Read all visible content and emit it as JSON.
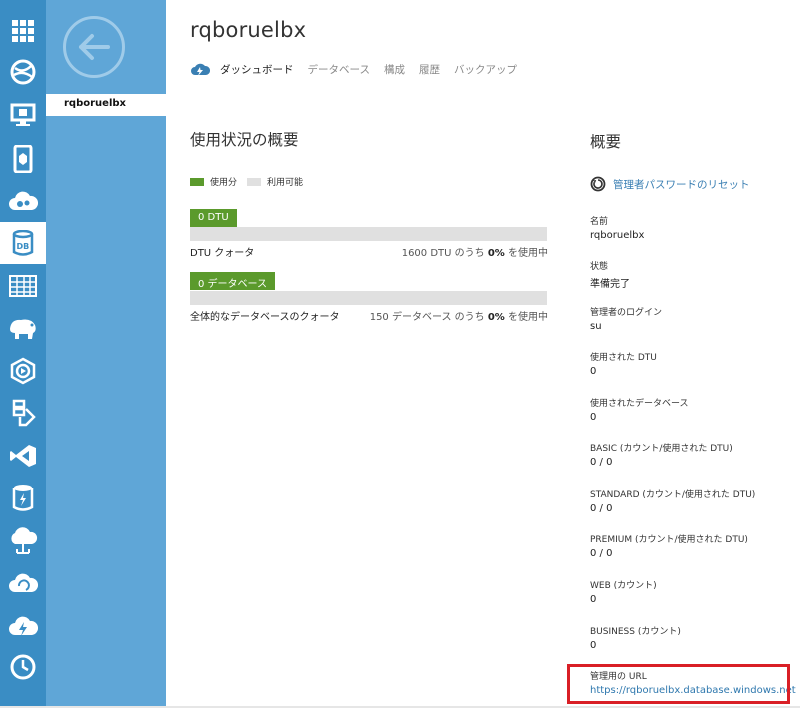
{
  "rail": {
    "items": [
      {
        "name": "all-items-icon"
      },
      {
        "name": "web-sites-icon"
      },
      {
        "name": "virtual-machines-icon"
      },
      {
        "name": "mobile-services-icon"
      },
      {
        "name": "cloud-services-icon"
      },
      {
        "name": "sql-database-icon",
        "label": "DB"
      },
      {
        "name": "storage-icon"
      },
      {
        "name": "hdinsight-icon"
      },
      {
        "name": "media-services-icon"
      },
      {
        "name": "service-bus-icon"
      },
      {
        "name": "visual-studio-online-icon"
      },
      {
        "name": "cache-icon"
      },
      {
        "name": "biztalk-services-icon"
      },
      {
        "name": "recovery-services-icon"
      },
      {
        "name": "cdn-icon"
      },
      {
        "name": "scheduler-icon"
      }
    ]
  },
  "nav": {
    "selected_item": "rqboruelbx"
  },
  "header": {
    "title": "rqboruelbx",
    "tabs": [
      {
        "label": "ダッシュボード",
        "active": true
      },
      {
        "label": "データベース",
        "active": false
      },
      {
        "label": "構成",
        "active": false
      },
      {
        "label": "履歴",
        "active": false
      },
      {
        "label": "バックアップ",
        "active": false
      }
    ]
  },
  "usage": {
    "title": "使用状況の概要",
    "legend_used": "使用分",
    "legend_available": "利用可能",
    "colors": {
      "used": "#5b9a2c",
      "available": "#e0e0e0"
    },
    "bars": [
      {
        "tag": "0 DTU",
        "fraction_used": 0,
        "label": "DTU クォータ",
        "total_prefix": "1600 DTU のうち ",
        "percent": "0%",
        "suffix": " を使用中"
      },
      {
        "tag": "0 データベース",
        "fraction_used": 0,
        "label": "全体的なデータベースのクォータ",
        "total_prefix": "150 データベース のうち ",
        "percent": "0%",
        "suffix": " を使用中"
      }
    ]
  },
  "overview": {
    "title": "概要",
    "reset_password_label": "管理者パスワードのリセット",
    "properties": [
      {
        "key": "名前",
        "value": "rqboruelbx"
      },
      {
        "key": "状態",
        "value": "準備完了"
      },
      {
        "key": "管理者のログイン",
        "value": "su"
      },
      {
        "key": "使用された DTU",
        "value": "0"
      },
      {
        "key": "使用されたデータベース",
        "value": "0"
      },
      {
        "key": "BASIC (カウント/使用された DTU)",
        "value": "0 / 0"
      },
      {
        "key": "STANDARD (カウント/使用された DTU)",
        "value": "0 / 0"
      },
      {
        "key": "PREMIUM (カウント/使用された DTU)",
        "value": "0 / 0"
      },
      {
        "key": "WEB (カウント)",
        "value": "0"
      },
      {
        "key": "BUSINESS (カウント)",
        "value": "0"
      },
      {
        "key": "管理用の URL",
        "value": "https://rqboruelbx.database.windows.net"
      }
    ]
  }
}
